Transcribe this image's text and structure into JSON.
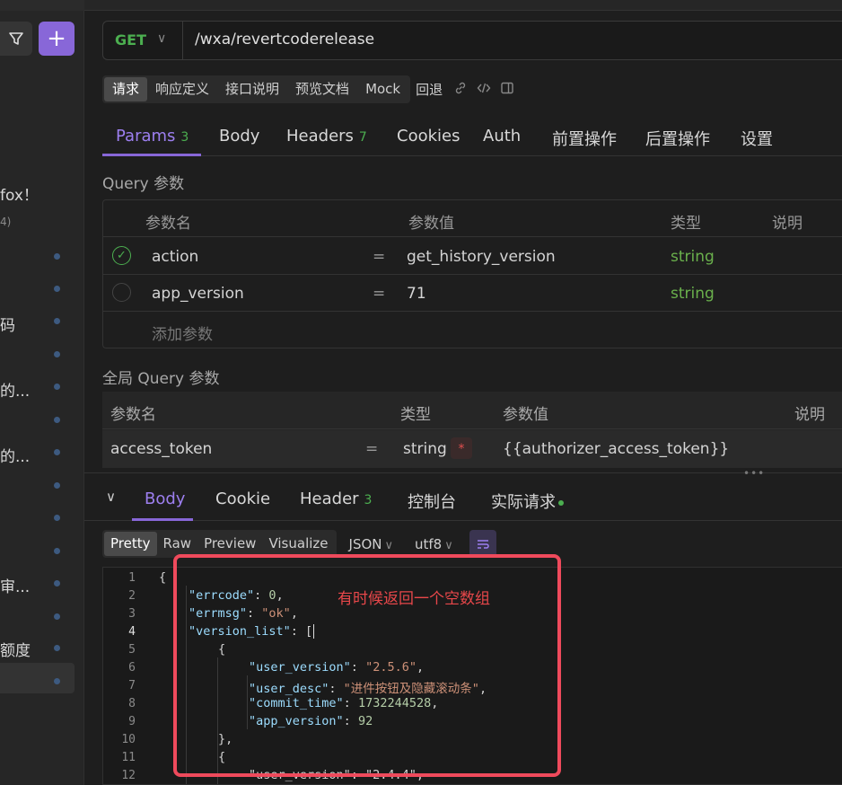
{
  "sidebar": {
    "texts": [
      {
        "label": "fox！"
      },
      {
        "label": "4)"
      },
      {
        "label": "码"
      },
      {
        "label": "的..."
      },
      {
        "label": "的..."
      },
      {
        "label": "审..."
      },
      {
        "label": "额度"
      }
    ]
  },
  "request": {
    "method": "GET",
    "url": "/wxa/revertcoderelease"
  },
  "subtabs": {
    "items": [
      "请求",
      "响应定义",
      "接口说明",
      "预览文档",
      "Mock"
    ],
    "extra": "回退"
  },
  "param_tabs": {
    "params": "Params",
    "params_count": "3",
    "body": "Body",
    "headers": "Headers",
    "headers_count": "7",
    "cookies": "Cookies",
    "auth": "Auth",
    "pre": "前置操作",
    "post": "后置操作",
    "settings": "设置"
  },
  "query": {
    "title": "Query 参数",
    "headers": {
      "name": "参数名",
      "value": "参数值",
      "type": "类型",
      "desc": "说明"
    },
    "rows": [
      {
        "name": "action",
        "eq": "=",
        "value": "get_history_version",
        "type": "string"
      },
      {
        "name": "app_version",
        "eq": "=",
        "value": "71",
        "type": "string"
      }
    ],
    "add_placeholder": "添加参数"
  },
  "global_query": {
    "title": "全局 Query 参数",
    "headers": {
      "name": "参数名",
      "type": "类型",
      "value": "参数值",
      "desc": "说明"
    },
    "row": {
      "name": "access_token",
      "eq": "=",
      "type": "string",
      "required": "*",
      "value": "{{authorizer_access_token}}"
    }
  },
  "response_tabs": {
    "body": "Body",
    "cookie": "Cookie",
    "header": "Header",
    "header_count": "3",
    "console": "控制台",
    "actual": "实际请求"
  },
  "view": {
    "modes": [
      "Pretty",
      "Raw",
      "Preview",
      "Visualize"
    ],
    "format": "JSON",
    "encoding": "utf8"
  },
  "code": {
    "line_numbers": [
      "1",
      "2",
      "3",
      "4",
      "5",
      "6",
      "7",
      "8",
      "9",
      "10",
      "11",
      "12"
    ],
    "errcode_key": "\"errcode\"",
    "errcode_val": "0",
    "errmsg_key": "\"errmsg\"",
    "errmsg_val": "\"ok\"",
    "version_list_key": "\"version_list\"",
    "user_version_key": "\"user_version\"",
    "user_version_val": "\"2.5.6\"",
    "user_desc_key": "\"user_desc\"",
    "user_desc_val": "\"进件按钮及隐藏滚动条\"",
    "commit_time_key": "\"commit_time\"",
    "commit_time_val": "1732244528",
    "app_version_key": "\"app_version\"",
    "app_version_val": "92",
    "partial_line": "\"user_version\": \"2.4.4\","
  },
  "annotation": {
    "text": "有时候返回一个空数组",
    "color": "#ef4a5c"
  },
  "colors": {
    "accent": "#8867d8",
    "method_green": "#4caf50",
    "string_type": "#6ab04c"
  }
}
